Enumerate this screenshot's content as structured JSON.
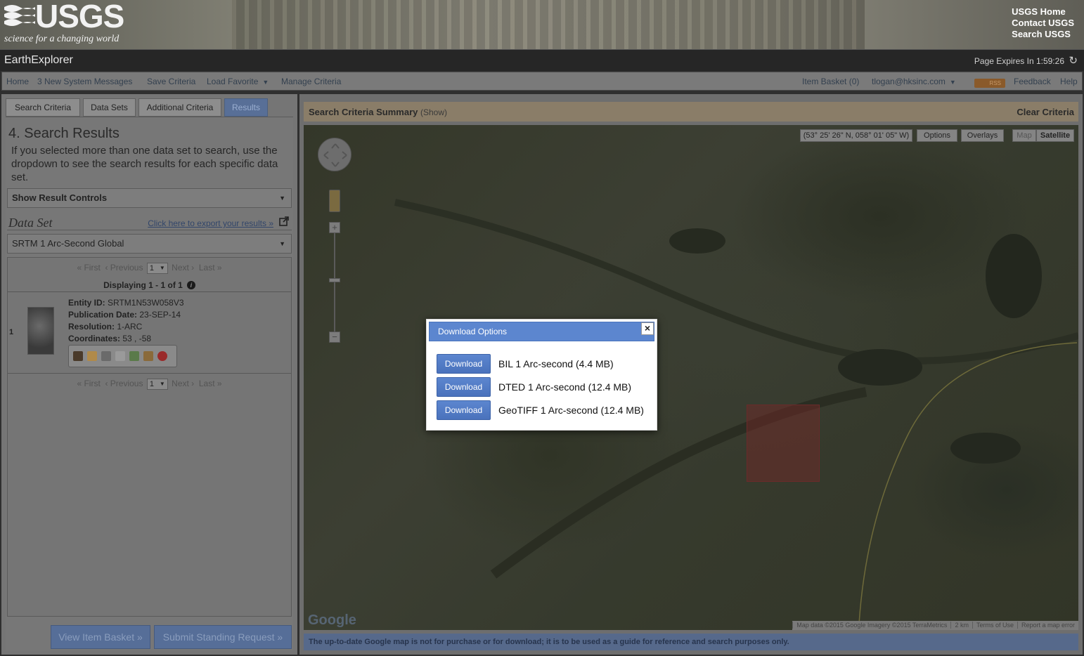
{
  "header": {
    "logo_text": "USGS",
    "tagline": "science for a changing world",
    "links": [
      "USGS Home",
      "Contact USGS",
      "Search USGS"
    ]
  },
  "titlebar": {
    "app_name": "EarthExplorer",
    "page_expires": "Page Expires In 1:59:26"
  },
  "nav": {
    "left": [
      "Home",
      "3 New System Messages",
      "Save Criteria",
      "Load Favorite",
      "Manage Criteria"
    ],
    "item_basket": "Item Basket (0)",
    "user": "tlogan@hksinc.com",
    "rss": "RSS",
    "feedback": "Feedback",
    "help": "Help"
  },
  "tabs": [
    "Search Criteria",
    "Data Sets",
    "Additional Criteria",
    "Results"
  ],
  "active_tab": "Results",
  "results": {
    "heading": "4. Search Results",
    "intro": "If you selected more than one data set to search, use the dropdown to see the search results for each specific data set.",
    "show_controls": "Show Result Controls",
    "dataset_title": "Data Set",
    "export_link": "Click here to export your results »",
    "dataset_selected": "SRTM 1 Arc-Second Global",
    "pager": {
      "first": "« First",
      "previous": "‹ Previous",
      "page": "1",
      "next": "Next ›",
      "last": "Last »"
    },
    "displaying": "Displaying 1 - 1 of 1",
    "row_number": "1",
    "entity_label": "Entity ID:",
    "entity_value": "SRTM1N53W058V3",
    "pubdate_label": "Publication Date:",
    "pubdate_value": "23-SEP-14",
    "resolution_label": "Resolution:",
    "resolution_value": "1-ARC",
    "coords_label": "Coordinates:",
    "coords_value": "53 , -58",
    "view_basket": "View Item Basket »",
    "standing_request": "Submit Standing Request »"
  },
  "summary": {
    "title": "Search Criteria Summary",
    "show": "(Show)",
    "clear": "Clear Criteria"
  },
  "map": {
    "coords": "(53° 25' 26\" N, 058° 01' 05\" W)",
    "options": "Options",
    "overlays": "Overlays",
    "map_type": "Map",
    "satellite": "Satellite",
    "google": "Google",
    "attribution": "Map data ©2015 Google Imagery ©2015 TerraMetrics",
    "scale": "2 km",
    "terms": "Terms of Use",
    "report": "Report a map error",
    "disclaimer": "The up-to-date Google map is not for purchase or for download; it is to be used as a guide for reference and search purposes only."
  },
  "download_modal": {
    "title": "Download Options",
    "close": "×",
    "button_label": "Download",
    "options": [
      "BIL 1 Arc-second (4.4 MB)",
      "DTED 1 Arc-second (12.4 MB)",
      "GeoTIFF 1 Arc-second (12.4 MB)"
    ]
  },
  "colors": {
    "accent": "#5c86cf",
    "header_bg": "#262626",
    "overlay_dim": "#6e6e6e"
  }
}
